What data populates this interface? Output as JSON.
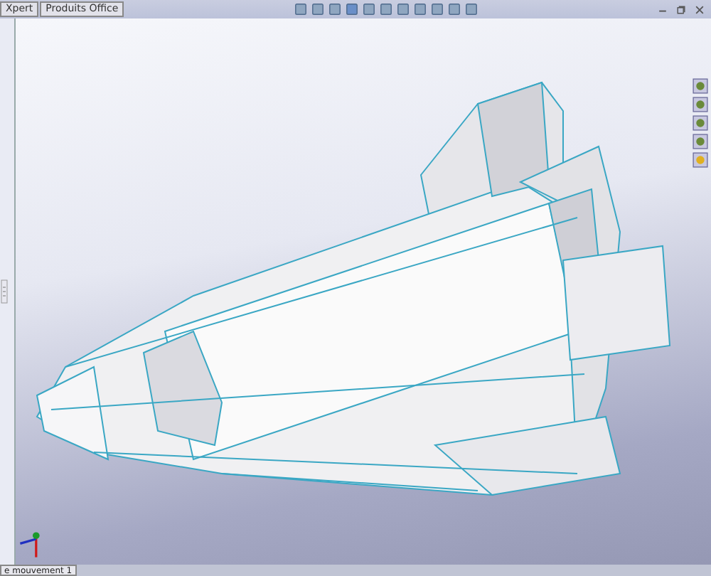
{
  "tabs": [
    {
      "label": "Xpert"
    },
    {
      "label": "Produits Office"
    }
  ],
  "bottom_tabs": [
    {
      "label": "e mouvement 1"
    }
  ]
}
